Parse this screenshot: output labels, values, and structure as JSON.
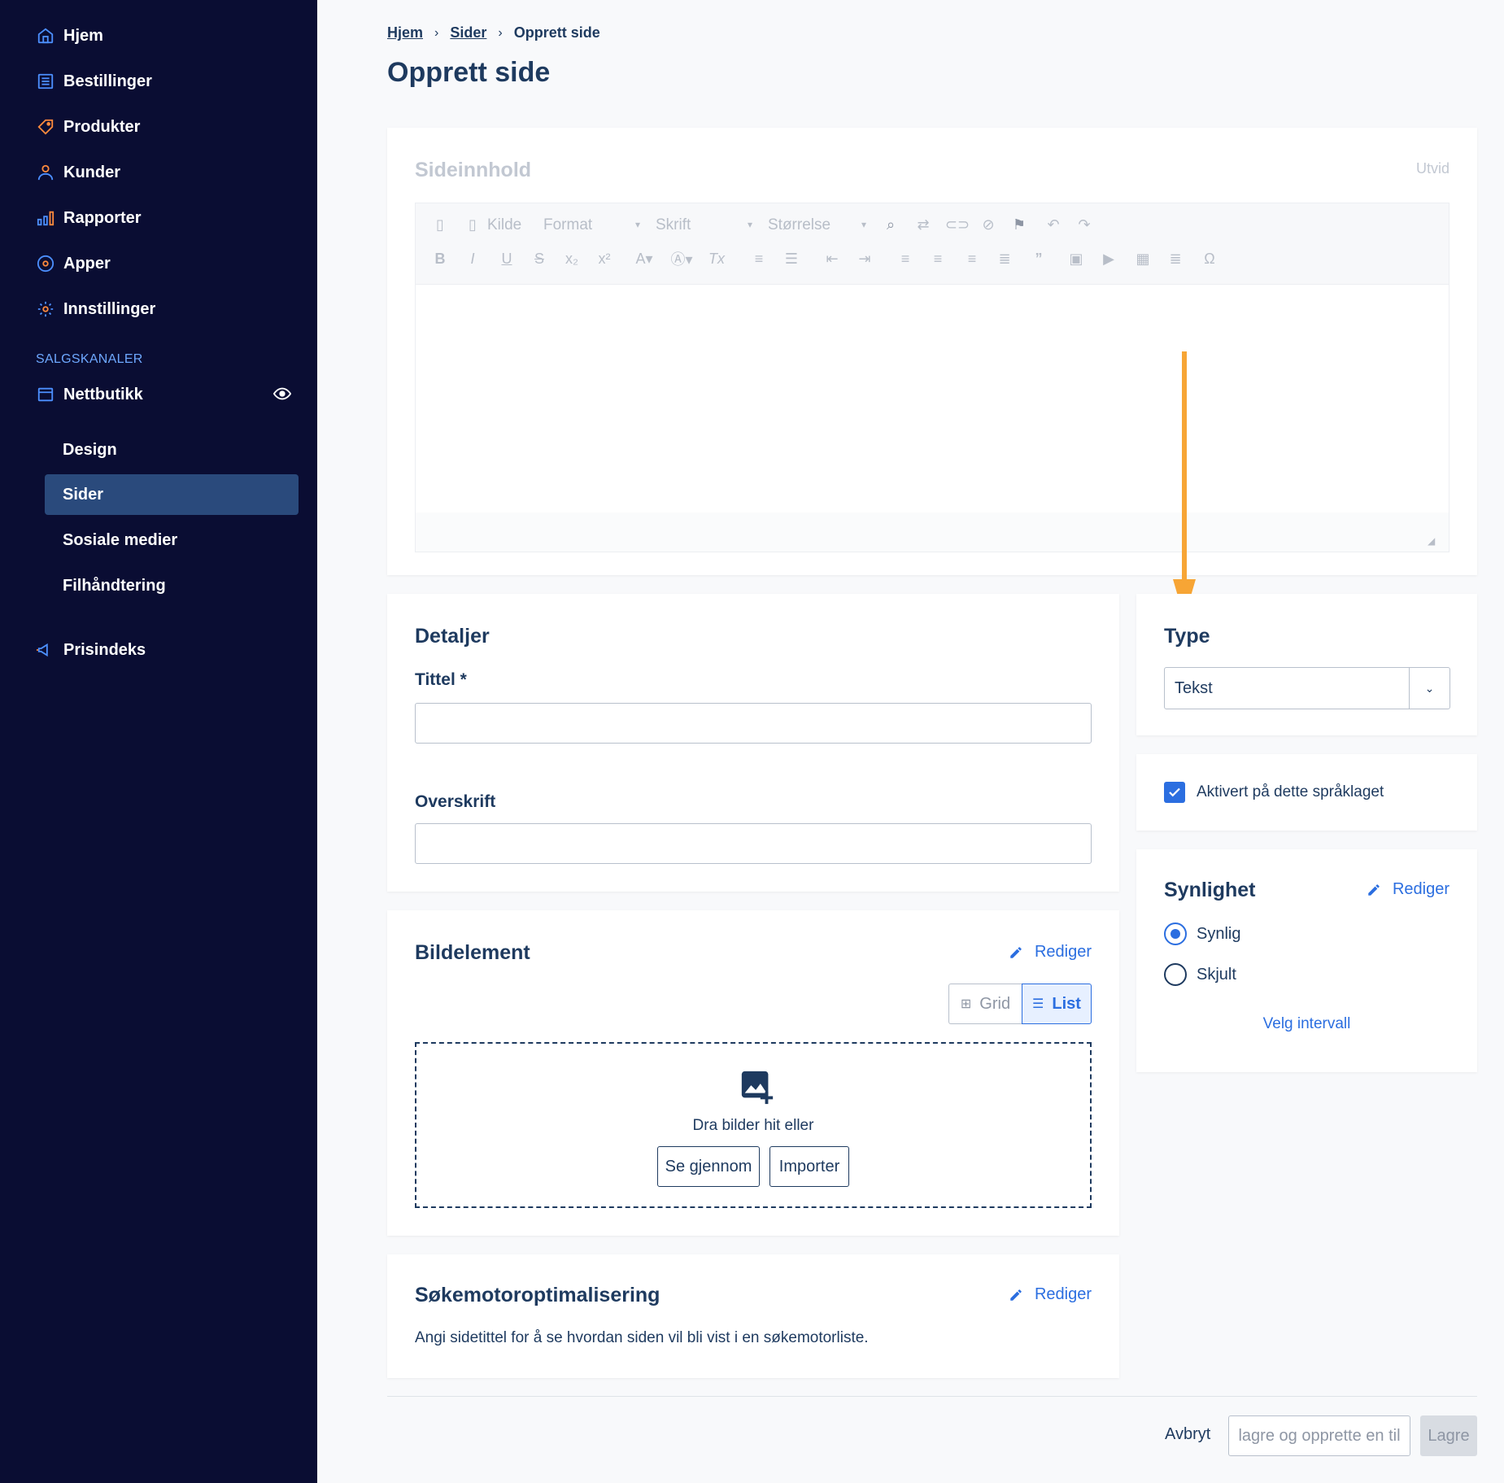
{
  "sidebar": {
    "items": [
      {
        "label": "Hjem",
        "icon": "home-icon"
      },
      {
        "label": "Bestillinger",
        "icon": "orders-icon"
      },
      {
        "label": "Produkter",
        "icon": "tag-icon"
      },
      {
        "label": "Kunder",
        "icon": "user-icon"
      },
      {
        "label": "Rapporter",
        "icon": "bar-chart-icon"
      },
      {
        "label": "Apper",
        "icon": "apps-icon"
      },
      {
        "label": "Innstillinger",
        "icon": "gear-icon"
      }
    ],
    "section_label": "SALGSKANALER",
    "channel": {
      "label": "Nettbutikk",
      "icon": "store-icon"
    },
    "sub_items": [
      {
        "label": "Design"
      },
      {
        "label": "Sider"
      },
      {
        "label": "Sosiale medier"
      },
      {
        "label": "Filhåndtering"
      }
    ],
    "price_index": {
      "label": "Prisindeks",
      "icon": "megaphone-icon"
    }
  },
  "breadcrumb": {
    "home": "Hjem",
    "pages": "Sider",
    "current": "Opprett side"
  },
  "page_title": "Opprett side",
  "content": {
    "title": "Sideinnhold",
    "expand": "Utvid",
    "toolbar": {
      "source": "Kilde",
      "format": "Format",
      "font": "Skrift",
      "size": "Størrelse"
    }
  },
  "details": {
    "title": "Detaljer",
    "title_label": "Tittel *",
    "heading_label": "Overskrift"
  },
  "image": {
    "title": "Bildelement",
    "edit": "Rediger",
    "grid": "Grid",
    "list": "List",
    "drop_text": "Dra bilder hit eller",
    "browse": "Se gjennom",
    "import": "Importer"
  },
  "seo": {
    "title": "Søkemotoroptimalisering",
    "edit": "Rediger",
    "description": "Angi sidetittel for å se hvordan siden vil bli vist i en søkemotorliste."
  },
  "type": {
    "title": "Type",
    "value": "Tekst"
  },
  "language": {
    "label": "Aktivert på dette språklaget",
    "checked": true
  },
  "visibility": {
    "title": "Synlighet",
    "edit": "Rediger",
    "visible": "Synlig",
    "hidden": "Skjult",
    "interval": "Velg intervall"
  },
  "footer": {
    "cancel": "Avbryt",
    "save_new": "lagre og opprette en til",
    "save": "Lagre"
  },
  "colors": {
    "sidebar": "#0a0d33",
    "active": "#2a4a7c",
    "accent": "#2b6ee0",
    "arrow": "#f7a535"
  }
}
